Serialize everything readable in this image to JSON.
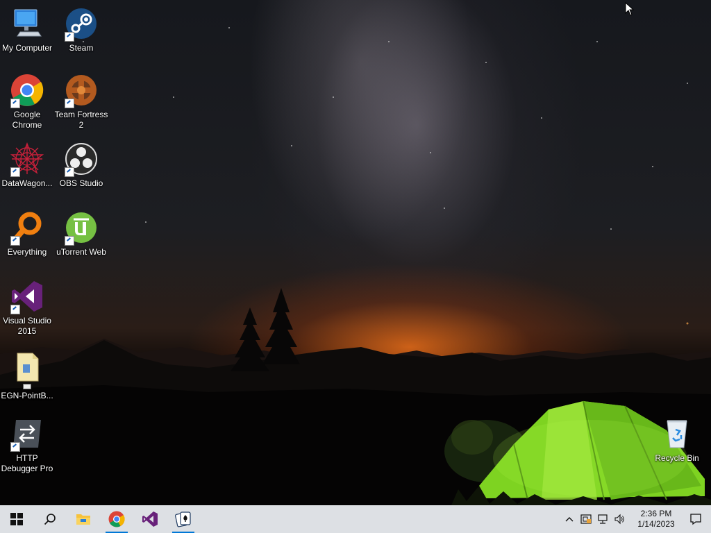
{
  "desktop": {
    "icons": [
      {
        "name": "My Computer",
        "icon": "computer-icon"
      },
      {
        "name": "Steam",
        "icon": "steam-icon"
      },
      {
        "name": "Google Chrome",
        "icon": "chrome-icon"
      },
      {
        "name": "Team Fortress 2",
        "icon": "tf2-icon"
      },
      {
        "name": "DataWagon...",
        "icon": "datawagon-icon"
      },
      {
        "name": "OBS Studio",
        "icon": "obs-icon"
      },
      {
        "name": "Everything",
        "icon": "everything-icon"
      },
      {
        "name": "uTorrent Web",
        "icon": "utorrent-icon"
      },
      {
        "name": "Visual Studio 2015",
        "icon": "visual-studio-icon"
      },
      {
        "name": "EGN-PointB...",
        "icon": "file-icon"
      },
      {
        "name": "HTTP Debugger Pro",
        "icon": "http-debugger-icon"
      },
      {
        "name": "Recycle Bin",
        "icon": "recycle-bin-icon"
      }
    ]
  },
  "taskbar": {
    "items": [
      {
        "icon": "windows-start-icon"
      },
      {
        "icon": "search-icon"
      },
      {
        "icon": "file-explorer-icon"
      },
      {
        "icon": "chrome-icon",
        "active": true
      },
      {
        "icon": "visual-studio-icon"
      },
      {
        "icon": "solitaire-icon",
        "active": true
      }
    ],
    "tray": {
      "icons": [
        "chevron-up-icon",
        "security-icon",
        "network-icon",
        "volume-icon"
      ],
      "time": "2:36 PM",
      "date": "1/14/2023"
    }
  },
  "colors": {
    "taskbar_bg": "#dde0e4",
    "active_indicator": "#0078d7",
    "tent_green": "#7ed321",
    "horizon_orange": "#e8691d"
  }
}
